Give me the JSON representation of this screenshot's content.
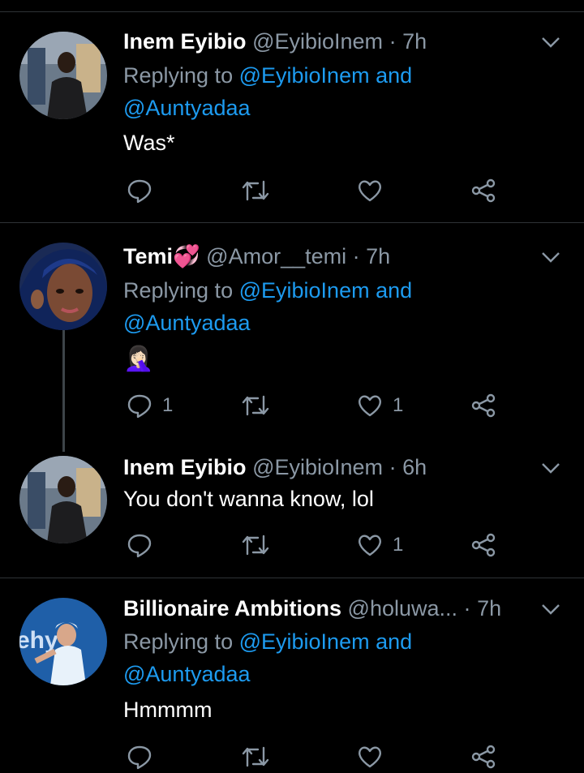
{
  "tweets": [
    {
      "name": "Inem Eyibio",
      "emoji": "",
      "handle": "@EyibioInem",
      "dot": "·",
      "time": "7h",
      "reply_prefix": "Replying to",
      "reply_mention1": "@EyibioInem",
      "reply_and": "and",
      "reply_mention2": "@Auntyadaa",
      "text": "Was*",
      "reply_count": "",
      "like_count": ""
    },
    {
      "name": "Temi",
      "emoji": "💞",
      "handle": "@Amor__temi",
      "dot": "·",
      "time": "7h",
      "reply_prefix": "Replying to",
      "reply_mention1": "@EyibioInem",
      "reply_and": "and",
      "reply_mention2": "@Auntyadaa",
      "text": "🤦🏻‍♀️",
      "reply_count": "1",
      "like_count": "1"
    },
    {
      "name": "Inem Eyibio",
      "emoji": "",
      "handle": "@EyibioInem",
      "dot": "·",
      "time": "6h",
      "text": "You don't wanna know, lol",
      "reply_count": "",
      "like_count": "1"
    },
    {
      "name": "Billionaire Ambitions",
      "emoji": "",
      "handle": "@holuwa...",
      "dot": "·",
      "time": "7h",
      "reply_prefix": "Replying to",
      "reply_mention1": "@EyibioInem",
      "reply_and": "and",
      "reply_mention2": "@Auntyadaa",
      "text": "Hmmmm",
      "reply_count": "",
      "like_count": ""
    }
  ],
  "icons": {
    "reply": "reply-icon",
    "retweet": "retweet-icon",
    "like": "like-icon",
    "share": "share-icon",
    "more": "chevron-down-icon"
  },
  "colors": {
    "background": "#000000",
    "text": "#ffffff",
    "muted": "#8b98a5",
    "accent": "#1d9bf0",
    "divider": "#2f3336"
  }
}
